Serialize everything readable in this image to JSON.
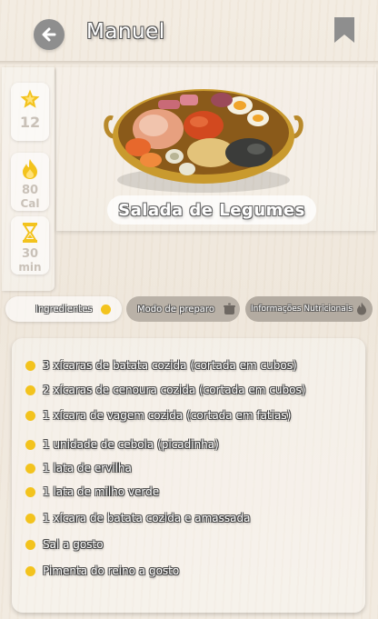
{
  "header": {
    "title": "Manuel"
  },
  "stats": {
    "servings": "12",
    "calories": "80",
    "calories_unit": "Cal",
    "time": "30",
    "time_unit": "min"
  },
  "recipe": {
    "title": "Salada de Legumes"
  },
  "tabs": [
    {
      "label": "Ingredientes",
      "active": true
    },
    {
      "label": "Modo de preparo",
      "active": false
    },
    {
      "label": "Informações Nutricionais",
      "active": false
    }
  ],
  "ingredients": [
    "3 xícaras de batata cozida (cortada em cubos)",
    "2 xícaras de cenoura cozida (cortada em cubos)",
    "1 xícara de vagem cozida (cortada em fatias)",
    "1 unidade de cebola (picadinha)",
    "1 lata de ervilha",
    "1 lata de milho verde",
    "1 xícara de batata cozida e amassada",
    "Sal a gosto",
    "Pimenta do reino a gosto"
  ],
  "colors": {
    "accent": "#f3c31d",
    "icon_gray": "#8e8e8e",
    "stat_text": "#c9c1b8"
  },
  "icons": {
    "back": "arrow-left-icon",
    "bookmark": "bookmark-icon",
    "servings": "star-icon",
    "calories": "flame-icon",
    "time": "hourglass-icon",
    "preparo": "pot-icon",
    "nutri": "flame-icon"
  }
}
